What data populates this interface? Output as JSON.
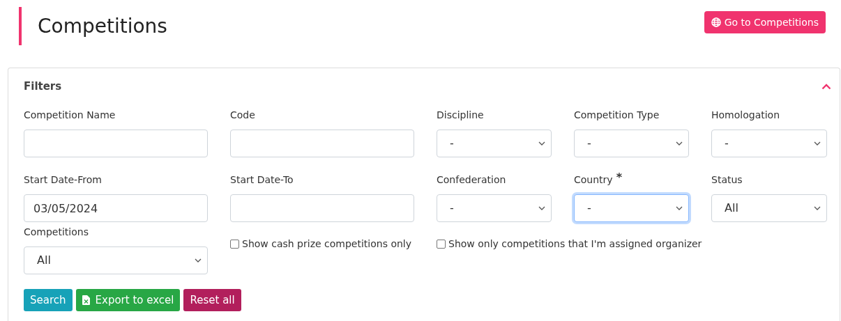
{
  "page": {
    "title": "Competitions",
    "button": "Go to Competitions"
  },
  "filters": {
    "title": "Filters",
    "expanded": true,
    "rows": [
      [
        {
          "kind": "text",
          "label": "Competition Name"
        },
        {
          "kind": "text",
          "label": "Code"
        },
        {
          "kind": "select",
          "label": "Discipline",
          "value": "-"
        },
        {
          "kind": "select",
          "label": "Competition Type",
          "value": "-"
        },
        {
          "kind": "select",
          "label": "Homologation",
          "value": "-"
        }
      ],
      [
        {
          "kind": "text",
          "label": "Start Date-From",
          "value": "03/05/2024"
        },
        {
          "kind": "text",
          "label": "Start Date-To"
        },
        {
          "kind": "select",
          "label": "Confederation",
          "value": "-"
        },
        {
          "kind": "select",
          "label": "Country",
          "required_mark": "*",
          "value": "-",
          "focused": true
        },
        {
          "kind": "select",
          "label": "Status",
          "value": "All"
        }
      ],
      [
        {
          "kind": "select",
          "label": "Competitions",
          "value": "All"
        },
        {
          "kind": "checkbox",
          "label": "Show cash prize competitions only",
          "checked": false
        },
        {
          "kind": "checkbox",
          "label": "Show only competitions that I'm assigned organizer",
          "checked": false
        }
      ]
    ],
    "buttons": [
      {
        "kind": "search",
        "label": "Search"
      },
      {
        "kind": "export",
        "label": "Export to excel"
      },
      {
        "kind": "reset",
        "label": "Reset all"
      }
    ]
  }
}
